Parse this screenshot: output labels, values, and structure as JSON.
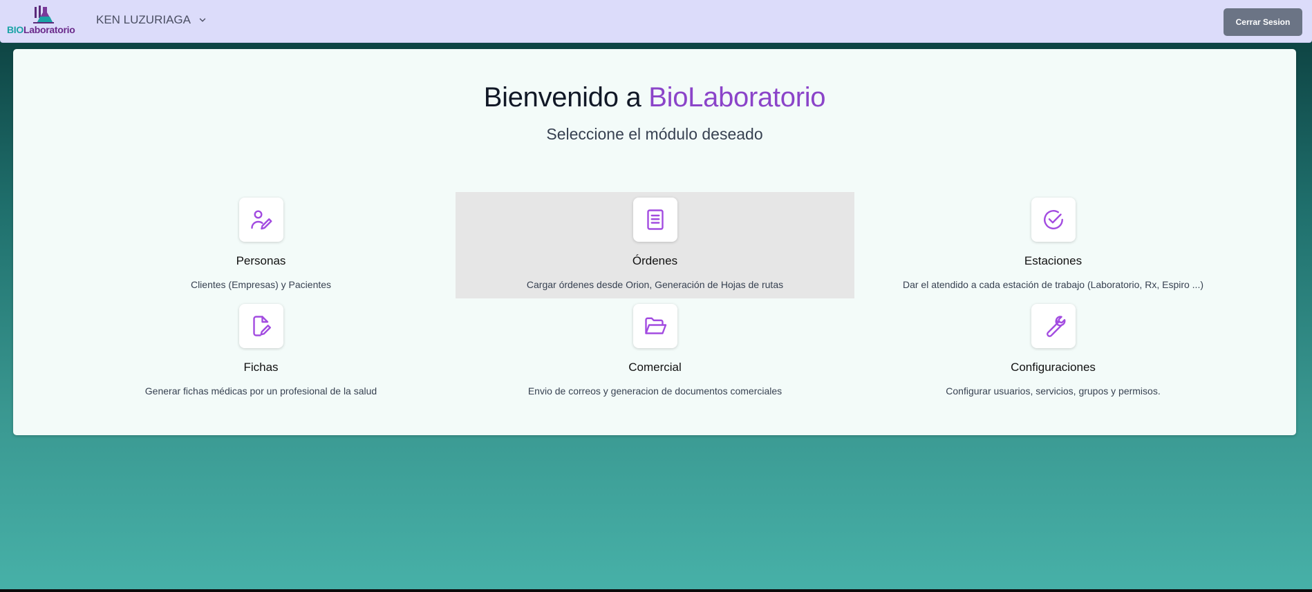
{
  "header": {
    "logo_bio": "BIO",
    "logo_lab": "Laboratorio",
    "user_name": "KEN LUZURIAGA",
    "logout_label": "Cerrar Sesion"
  },
  "welcome": {
    "title_prefix": "Bienvenido a",
    "title_brand": "BioLaboratorio",
    "subtitle": "Seleccione el módulo deseado"
  },
  "modules": [
    {
      "title": "Personas",
      "description": "Clientes (Empresas) y Pacientes",
      "icon": "user-edit-icon"
    },
    {
      "title": "Órdenes",
      "description": "Cargar órdenes desde Orion, Generación de Hojas de rutas",
      "icon": "book-icon"
    },
    {
      "title": "Estaciones",
      "description": "Dar el atendido a cada estación de trabajo (Laboratorio, Rx, Espiro ...)",
      "icon": "check-circle-icon"
    },
    {
      "title": "Fichas",
      "description": "Generar fichas médicas por un profesional de la salud",
      "icon": "file-edit-icon"
    },
    {
      "title": "Comercial",
      "description": "Envio de correos y generacion de documentos comerciales",
      "icon": "folder-open-icon"
    },
    {
      "title": "Configuraciones",
      "description": "Configurar usuarios, servicios, grupos y permisos.",
      "icon": "wrench-icon"
    }
  ],
  "colors": {
    "accent": "#8b44c9",
    "icon": "#a24be0",
    "topbar": "#dcdcfa",
    "logout": "#6b7485"
  }
}
